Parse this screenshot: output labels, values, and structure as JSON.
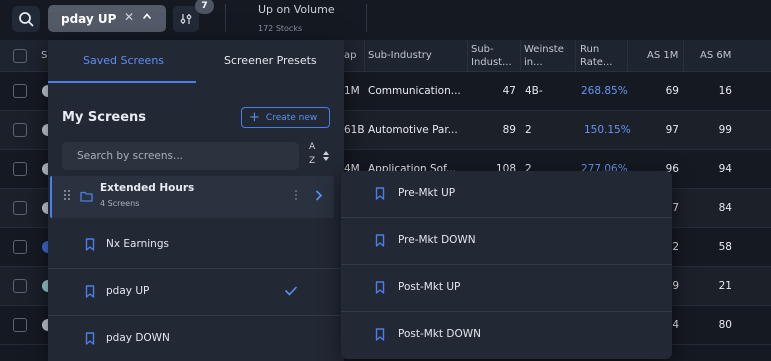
{
  "toolbar": {
    "active_screen": "pday UP",
    "filter_count": "7",
    "info_title": "Up on Volume",
    "info_subtitle": "172 Stocks"
  },
  "table": {
    "headers": {
      "symbol": "S",
      "mcap": "ap",
      "sub_industry": "Sub-Industry",
      "sub_industry_rank": [
        "Sub-",
        "Indust..."
      ],
      "weinstein": [
        "Weinste",
        "in..."
      ],
      "run_rate": [
        "Run",
        "Rate..."
      ],
      "rs1m": "AS 1M",
      "rs6m": "AS 6M"
    },
    "rows": [
      {
        "mcap": "1M",
        "sub_industry": "Communication...",
        "sub_rank": "47",
        "weinstein": "4B-",
        "run_rate": "268.85%",
        "rs1m": "69",
        "rs6m": "16"
      },
      {
        "mcap": "61B",
        "sub_industry": "Automotive Par...",
        "sub_rank": "89",
        "weinstein": "2",
        "run_rate": "150.15%",
        "rs1m": "97",
        "rs6m": "99"
      },
      {
        "mcap": "4M",
        "sub_industry": "Application Sof...",
        "sub_rank": "108",
        "weinstein": "2",
        "run_rate": "277.06%",
        "rs1m": "96",
        "rs6m": "94"
      },
      {
        "rs1m": "7",
        "rs6m": "84"
      },
      {
        "rs1m": "2",
        "rs6m": "58"
      },
      {
        "rs1m": "9",
        "rs6m": "21"
      },
      {
        "rs1m": "4",
        "rs6m": "80"
      }
    ]
  },
  "panel": {
    "tabs": [
      "Saved Screens",
      "Screener Presets"
    ],
    "heading": "My Screens",
    "create_label": "Create new",
    "search_placeholder": "Search by screens...",
    "sort_a": "A",
    "sort_z": "Z",
    "folder": {
      "name": "Extended Hours",
      "count": "4 Screens"
    },
    "items": [
      "Nx Earnings",
      "pday UP",
      "pday DOWN"
    ]
  },
  "submenu": {
    "items": [
      "Pre-Mkt UP",
      "Pre-Mkt DOWN",
      "Post-Mkt UP",
      "Post-Mkt DOWN"
    ]
  },
  "colors": {
    "accent": "#4a7fe8",
    "background": "#151a22",
    "panel": "#222834"
  }
}
